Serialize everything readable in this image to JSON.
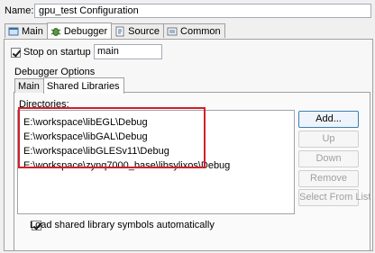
{
  "window": {
    "name_label": "Name:",
    "name_value": "gpu_test Configuration"
  },
  "top_tabs": [
    {
      "label": "Main",
      "icon": "main-tab-icon",
      "active": false
    },
    {
      "label": "Debugger",
      "icon": "debugger-icon",
      "active": true
    },
    {
      "label": "Source",
      "icon": "source-icon",
      "active": false
    },
    {
      "label": "Common",
      "icon": "common-icon",
      "active": false
    }
  ],
  "stop_on_startup": {
    "label": "Stop on startup at:",
    "checked": true,
    "value": "main"
  },
  "debugger_options": {
    "label": "Debugger Options",
    "tabs": [
      {
        "label": "Main",
        "active": false
      },
      {
        "label": "Shared Libraries",
        "active": true
      }
    ]
  },
  "directories": {
    "label": "Directories:",
    "items": [
      "E:\\workspace\\libEGL\\Debug",
      "E:\\workspace\\libGAL\\Debug",
      "E:\\workspace\\libGLESv11\\Debug",
      "E:\\workspace\\zynq7000_base\\libsylixos\\Debug"
    ]
  },
  "buttons": {
    "add": "Add...",
    "up": "Up",
    "down": "Down",
    "remove": "Remove",
    "select_from_list": "Select From List"
  },
  "load_symbols": {
    "label": "Load shared library symbols automatically",
    "checked": true
  },
  "colors": {
    "highlight": "#d21f2b",
    "panel_border": "#a0a0a0"
  }
}
